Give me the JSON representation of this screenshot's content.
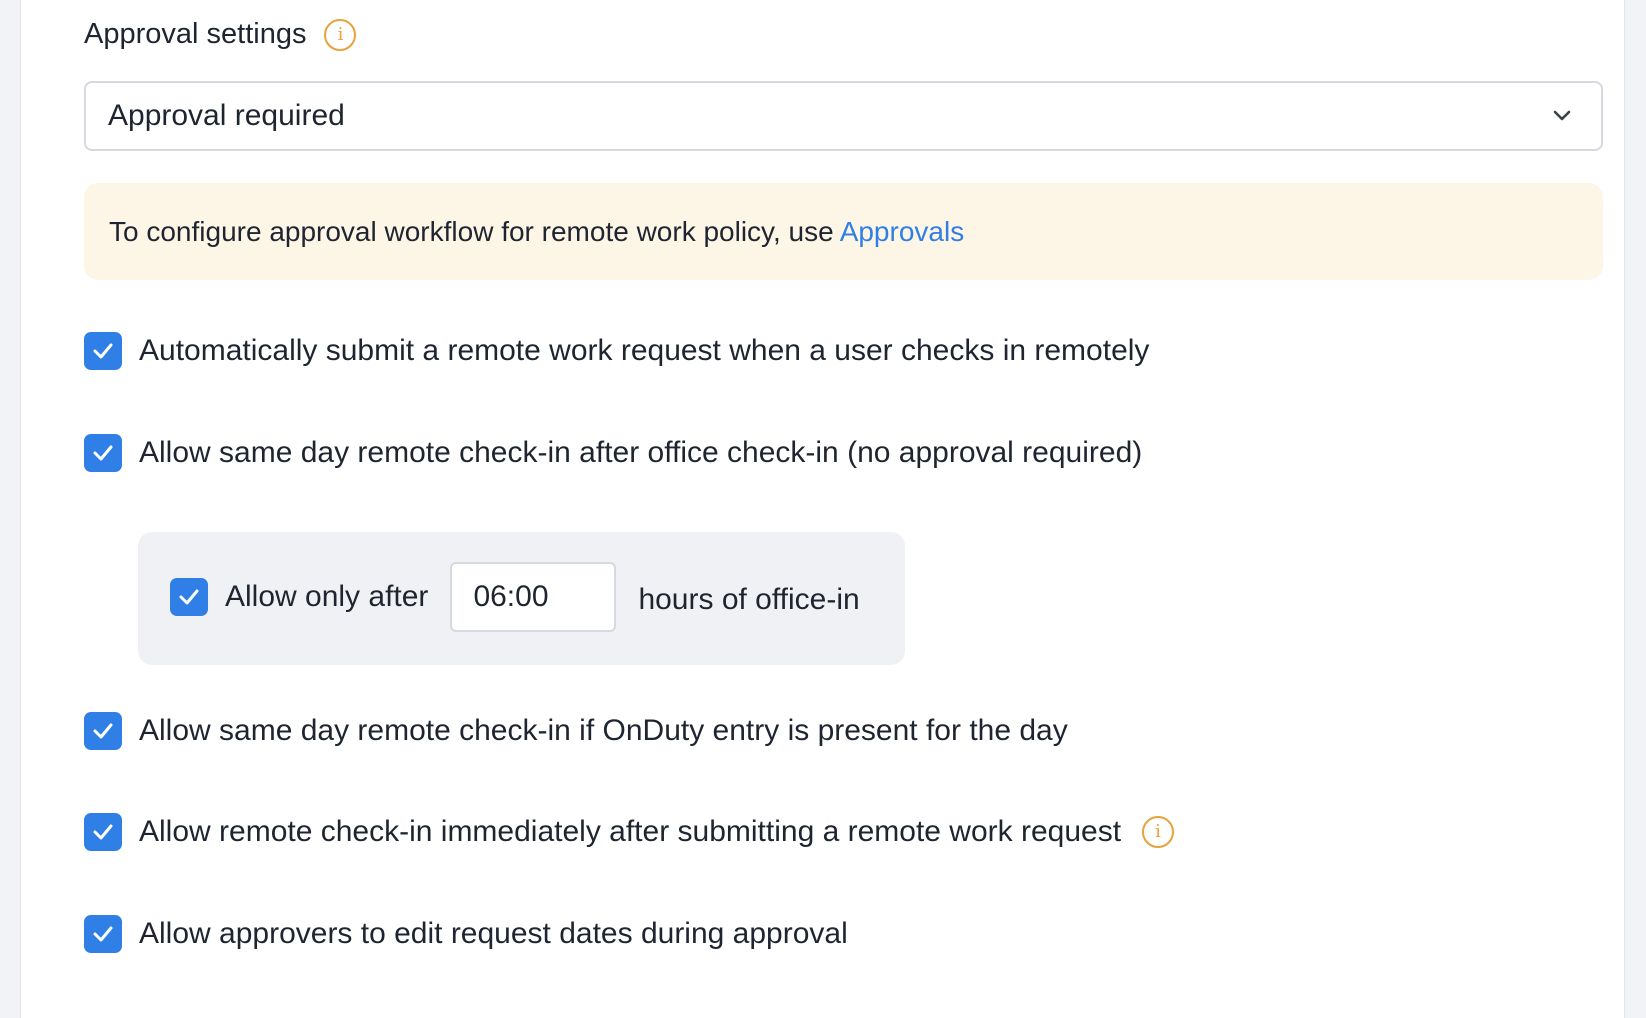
{
  "approval_settings": {
    "title": "Approval settings",
    "select_value": "Approval required",
    "notice_text": "To configure approval workflow for remote work policy, use",
    "notice_link": "Approvals"
  },
  "options": {
    "auto_submit": {
      "label": "Automatically submit a remote work request when a user checks in remotely",
      "checked": true
    },
    "same_day_office": {
      "label": "Allow same day remote check-in after office check-in (no approval required)",
      "checked": true
    },
    "allow_only_after": {
      "label": "Allow only after",
      "value": "06:00",
      "suffix": "hours of office-in",
      "checked": true
    },
    "onduty": {
      "label": "Allow same day remote check-in if OnDuty entry is present for the day",
      "checked": true
    },
    "immediate_checkin": {
      "label": "Allow remote check-in immediately after submitting a remote work request",
      "checked": true
    },
    "edit_dates": {
      "label": "Allow approvers to edit request dates during approval",
      "checked": true
    }
  },
  "colors": {
    "accent": "#2f7fe6",
    "info": "#e8a23b",
    "notice_bg": "#fdf6e6",
    "subbox_bg": "#f0f1f4"
  },
  "icons": {
    "info": "info-circle-icon",
    "dropdown": "chevron-down-icon",
    "check": "checkmark-icon"
  }
}
